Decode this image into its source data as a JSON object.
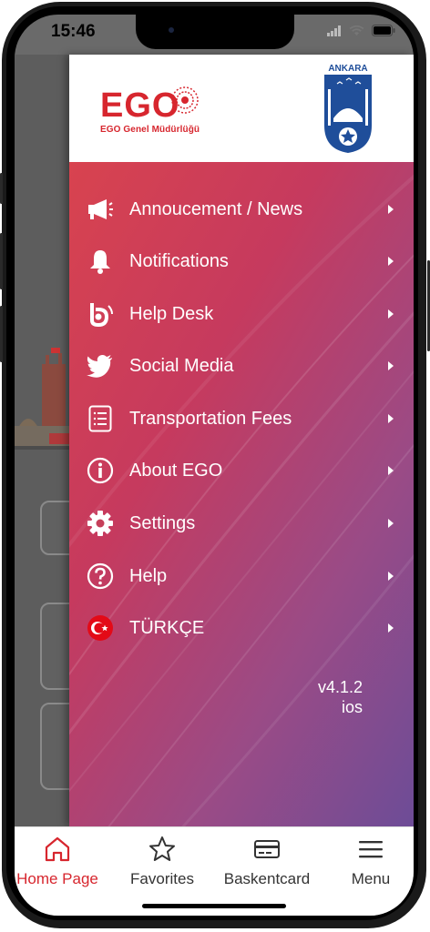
{
  "status_bar": {
    "time": "15:46"
  },
  "drawer": {
    "ego_logo_text": "EGO",
    "ego_subtitle": "EGO Genel Müdürlüğü",
    "ankara_logo_text": "ANKARA",
    "menu": [
      {
        "label": "Annoucement / News",
        "icon": "megaphone-icon"
      },
      {
        "label": "Notifications",
        "icon": "bell-icon"
      },
      {
        "label": "Help Desk",
        "icon": "helpdesk-icon"
      },
      {
        "label": "Social Media",
        "icon": "twitter-icon"
      },
      {
        "label": "Transportation Fees",
        "icon": "list-document-icon"
      },
      {
        "label": "About EGO",
        "icon": "info-icon"
      },
      {
        "label": "Settings",
        "icon": "gear-icon"
      },
      {
        "label": "Help",
        "icon": "question-icon"
      },
      {
        "label": "TÜRKÇE",
        "icon": "turkey-flag-icon"
      }
    ],
    "version": "v4.1.2",
    "platform": "ios"
  },
  "tabbar": {
    "tabs": [
      {
        "label": "Home Page",
        "icon": "home-icon",
        "active": true
      },
      {
        "label": "Favorites",
        "icon": "star-icon",
        "active": false
      },
      {
        "label": "Baskentcard",
        "icon": "card-icon",
        "active": false
      },
      {
        "label": "Menu",
        "icon": "hamburger-icon",
        "active": false
      }
    ]
  },
  "colors": {
    "brand_red": "#d7262e",
    "drawer_gradient_start": "#d8434f",
    "drawer_gradient_end": "#6d4c97",
    "ankara_blue": "#1f4e9a"
  }
}
